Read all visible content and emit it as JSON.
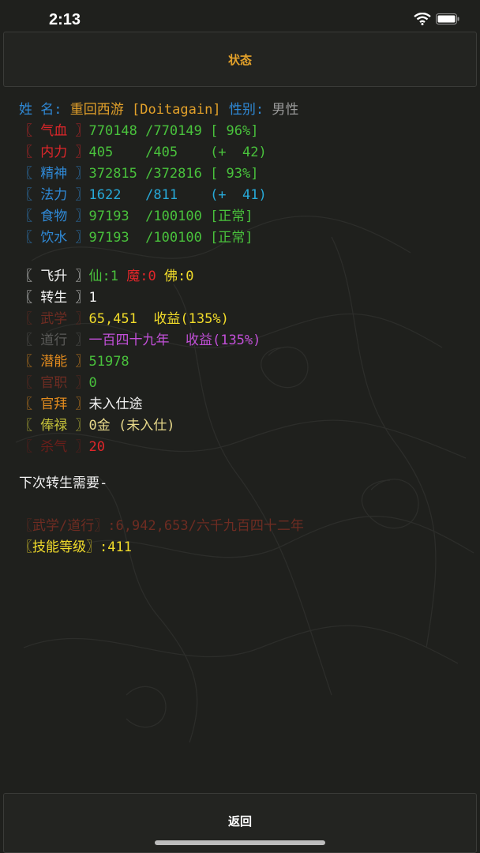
{
  "status_bar": {
    "time": "2:13"
  },
  "header": {
    "title": "状态"
  },
  "profile": {
    "name_label": "姓 名:",
    "name_value": "重回西游",
    "account": "[Doitagain]",
    "gender_label": "性别:",
    "gender_value": "男性"
  },
  "vitals": [
    {
      "label": "〖 气血 〗",
      "current": "770148",
      "max": "/770149",
      "extra": "[ 96%]"
    },
    {
      "label": "〖 内力 〗",
      "current": "405",
      "max": "/405",
      "extra": "(+  42)"
    },
    {
      "label": "〖 精神 〗",
      "current": "372815",
      "max": "/372816",
      "extra": "[ 93%]"
    },
    {
      "label": "〖 法力 〗",
      "current": "1622",
      "max": "/811",
      "extra": "(+  41)"
    },
    {
      "label": "〖 食物 〗",
      "current": "97193",
      "max": "/100100",
      "extra": "[正常]"
    },
    {
      "label": "〖 饮水 〗",
      "current": "97193",
      "max": "/100100",
      "extra": "[正常]"
    }
  ],
  "ascension": {
    "label": "〖 飞升 〗",
    "immortal": "仙:1",
    "demon": "魔:0",
    "buddha": "佛:0"
  },
  "rebirth": {
    "label": "〖 转生 〗",
    "value": "1"
  },
  "martial": {
    "label": "〖 武学 〗",
    "value": "65,451",
    "income": "收益(135%)"
  },
  "daoxing": {
    "label": "〖 道行 〗",
    "value": "一百四十九年",
    "income": "收益(135%)"
  },
  "potential": {
    "label": "〖 潜能 〗",
    "value": "51978"
  },
  "official_post": {
    "label": "〖 官职 〗",
    "value": "0"
  },
  "official_rank": {
    "label": "〖 官拜 〗",
    "value": "未入仕途"
  },
  "salary": {
    "label": "〖 俸禄 〗",
    "value": "0金 (未入仕)"
  },
  "killing": {
    "label": "〖 杀气 〗",
    "value": "20"
  },
  "next_rebirth": {
    "heading": "下次转生需要-",
    "requirement_label": "〖武学/道行〗",
    "requirement_value": ":6,942,653/六千九百四十二年",
    "skill_label": "〖技能等级〗",
    "skill_value": ":411"
  },
  "footer": {
    "back_label": "返回"
  }
}
